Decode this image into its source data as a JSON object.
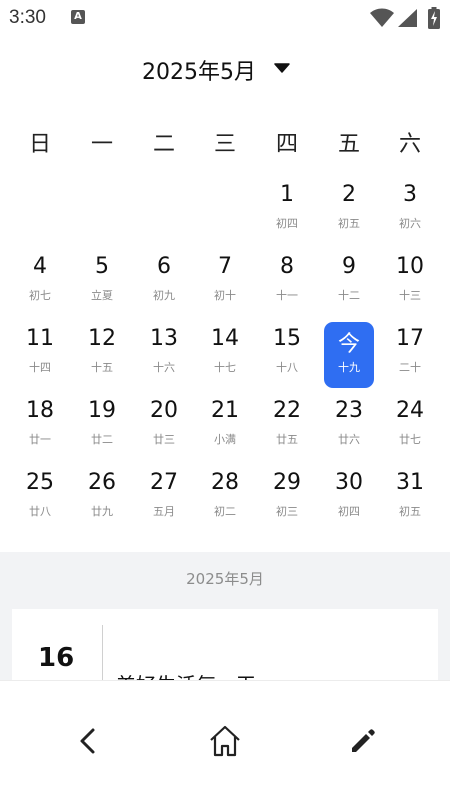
{
  "status_bar": {
    "time": "3:30",
    "a_badge": "A",
    "icons": [
      "wifi-icon",
      "signal-icon",
      "battery-charging-icon"
    ]
  },
  "header": {
    "month_title": "2025年5月",
    "caret_icon": "caret-down-icon"
  },
  "weekdays": [
    "日",
    "一",
    "二",
    "三",
    "四",
    "五",
    "六"
  ],
  "weeks": [
    [
      null,
      null,
      null,
      null,
      {
        "day": "1",
        "lunar": "初四"
      },
      {
        "day": "2",
        "lunar": "初五"
      },
      {
        "day": "3",
        "lunar": "初六"
      }
    ],
    [
      {
        "day": "4",
        "lunar": "初七"
      },
      {
        "day": "5",
        "lunar": "立夏"
      },
      {
        "day": "6",
        "lunar": "初九"
      },
      {
        "day": "7",
        "lunar": "初十"
      },
      {
        "day": "8",
        "lunar": "十一"
      },
      {
        "day": "9",
        "lunar": "十二"
      },
      {
        "day": "10",
        "lunar": "十三"
      }
    ],
    [
      {
        "day": "11",
        "lunar": "十四"
      },
      {
        "day": "12",
        "lunar": "十五"
      },
      {
        "day": "13",
        "lunar": "十六"
      },
      {
        "day": "14",
        "lunar": "十七"
      },
      {
        "day": "15",
        "lunar": "十八"
      },
      {
        "day": "今",
        "lunar": "十九",
        "today": true
      },
      {
        "day": "17",
        "lunar": "二十"
      }
    ],
    [
      {
        "day": "18",
        "lunar": "廿一"
      },
      {
        "day": "19",
        "lunar": "廿二"
      },
      {
        "day": "20",
        "lunar": "廿三"
      },
      {
        "day": "21",
        "lunar": "小满"
      },
      {
        "day": "22",
        "lunar": "廿五"
      },
      {
        "day": "23",
        "lunar": "廿六"
      },
      {
        "day": "24",
        "lunar": "廿七"
      }
    ],
    [
      {
        "day": "25",
        "lunar": "廿八"
      },
      {
        "day": "26",
        "lunar": "廿九"
      },
      {
        "day": "27",
        "lunar": "五月"
      },
      {
        "day": "28",
        "lunar": "初二"
      },
      {
        "day": "29",
        "lunar": "初三"
      },
      {
        "day": "30",
        "lunar": "初四"
      },
      {
        "day": "31",
        "lunar": "初五"
      }
    ]
  ],
  "events": {
    "month_label": "2025年5月",
    "card": {
      "day": "16",
      "title": "美好生活每一天"
    }
  },
  "bottom_nav": {
    "items": [
      "back-icon",
      "home-icon",
      "edit-icon"
    ]
  },
  "colors": {
    "today_bg": "#2f6ef2",
    "lunar_text": "#8a8a8a",
    "events_bg": "#f2f3f5"
  }
}
